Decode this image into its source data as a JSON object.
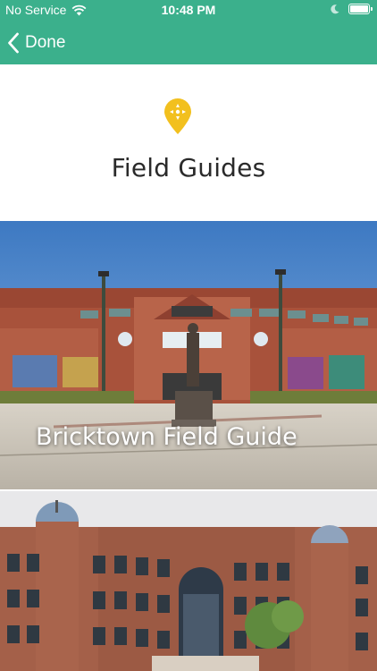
{
  "status_bar": {
    "carrier": "No Service",
    "time": "10:48 PM"
  },
  "nav": {
    "done_label": "Done"
  },
  "header": {
    "icon": "map-pin-icon",
    "title": "Field Guides"
  },
  "cards": [
    {
      "title": "Bricktown Field Guide",
      "image": "ballpark-photo"
    },
    {
      "title": "",
      "image": "brick-building-photo"
    }
  ],
  "colors": {
    "accent": "#3bb08c",
    "pin": "#f2c01e"
  }
}
